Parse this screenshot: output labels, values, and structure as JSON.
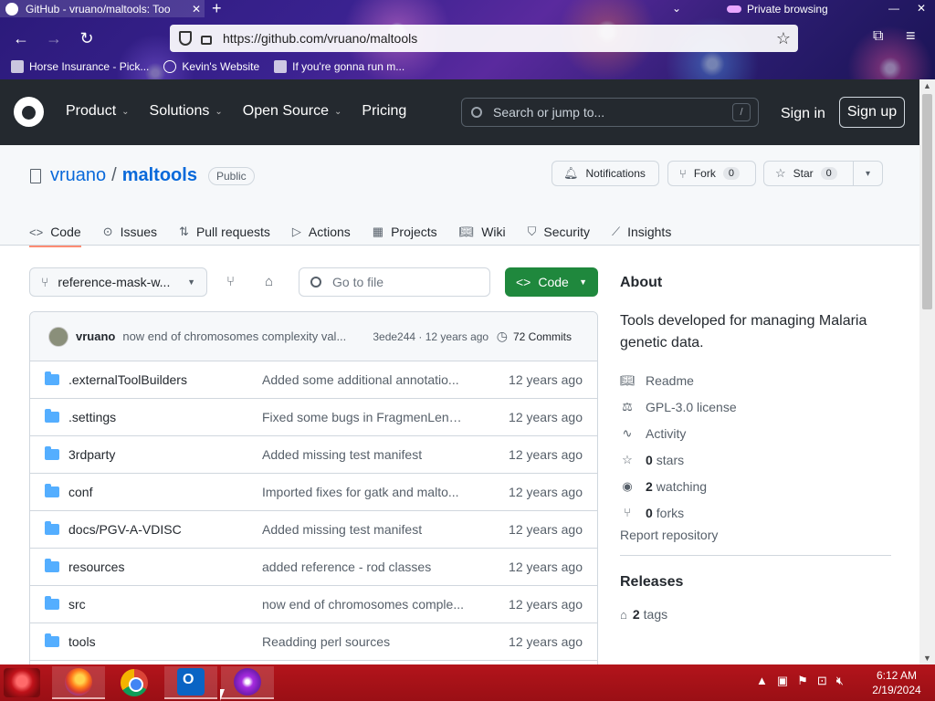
{
  "browser": {
    "tab_title": "GitHub - vruano/maltools: Too",
    "tab_close": "✕",
    "new_tab": "+",
    "tab_list": "⌄",
    "private_label": "Private browsing",
    "window_min": "—",
    "window_close": "✕",
    "url": "https://github.com/vruano/maltools",
    "bookmarks": [
      "Horse Insurance - Pick...",
      "Kevin's Website",
      "If you're gonna run m..."
    ]
  },
  "gh_header": {
    "nav": [
      "Product",
      "Solutions",
      "Open Source",
      "Pricing"
    ],
    "search_placeholder": "Search or jump to...",
    "search_key": "/",
    "sign_in": "Sign in",
    "sign_up": "Sign up"
  },
  "repo": {
    "owner": "vruano",
    "separator": "/",
    "name": "maltools",
    "visibility": "Public",
    "notifications_label": "Notifications",
    "fork_label": "Fork",
    "fork_count": "0",
    "star_label": "Star",
    "star_count": "0",
    "tabs": [
      "Code",
      "Issues",
      "Pull requests",
      "Actions",
      "Projects",
      "Wiki",
      "Security",
      "Insights"
    ]
  },
  "toolbar": {
    "branch": "reference-mask-w...",
    "go_to_file": "Go to file",
    "code_button": "Code"
  },
  "latest_commit": {
    "user": "vruano",
    "message": "now end of chromosomes complexity val...",
    "sha_time": "3ede244 · 12 years ago",
    "commits": "72 Commits"
  },
  "files": [
    {
      "name": ".externalToolBuilders",
      "message": "Added some additional annotatio...",
      "date": "12 years ago"
    },
    {
      "name": ".settings",
      "message": "Fixed some bugs in FragmenLengt...",
      "date": "12 years ago"
    },
    {
      "name": "3rdparty",
      "message": "Added missing test manifest",
      "date": "12 years ago"
    },
    {
      "name": "conf",
      "message": "Imported fixes for gatk and malto...",
      "date": "12 years ago"
    },
    {
      "name": "docs/PGV-A-VDISC",
      "message": "Added missing test manifest",
      "date": "12 years ago"
    },
    {
      "name": "resources",
      "message": "added reference - rod classes",
      "date": "12 years ago"
    },
    {
      "name": "src",
      "message": "now end of chromosomes comple...",
      "date": "12 years ago"
    },
    {
      "name": "tools",
      "message": "Readding perl sources",
      "date": "12 years ago"
    }
  ],
  "about": {
    "heading": "About",
    "description": "Tools developed for managing Malaria genetic data.",
    "readme": "Readme",
    "license": "GPL-3.0 license",
    "activity": "Activity",
    "stars_count": "0",
    "stars_label": "stars",
    "watching_count": "2",
    "watching_label": "watching",
    "forks_count": "0",
    "forks_label": "forks",
    "report": "Report repository",
    "releases_heading": "Releases",
    "tags_count": "2",
    "tags_label": "tags"
  },
  "taskbar": {
    "time": "6:12 AM",
    "date": "2/19/2024"
  },
  "colors": {
    "header_bg": "#24292f",
    "link": "#0969da",
    "code_green": "#1f883d",
    "active_tab_underline": "#fd8c73",
    "taskbar": "#b3141b"
  }
}
